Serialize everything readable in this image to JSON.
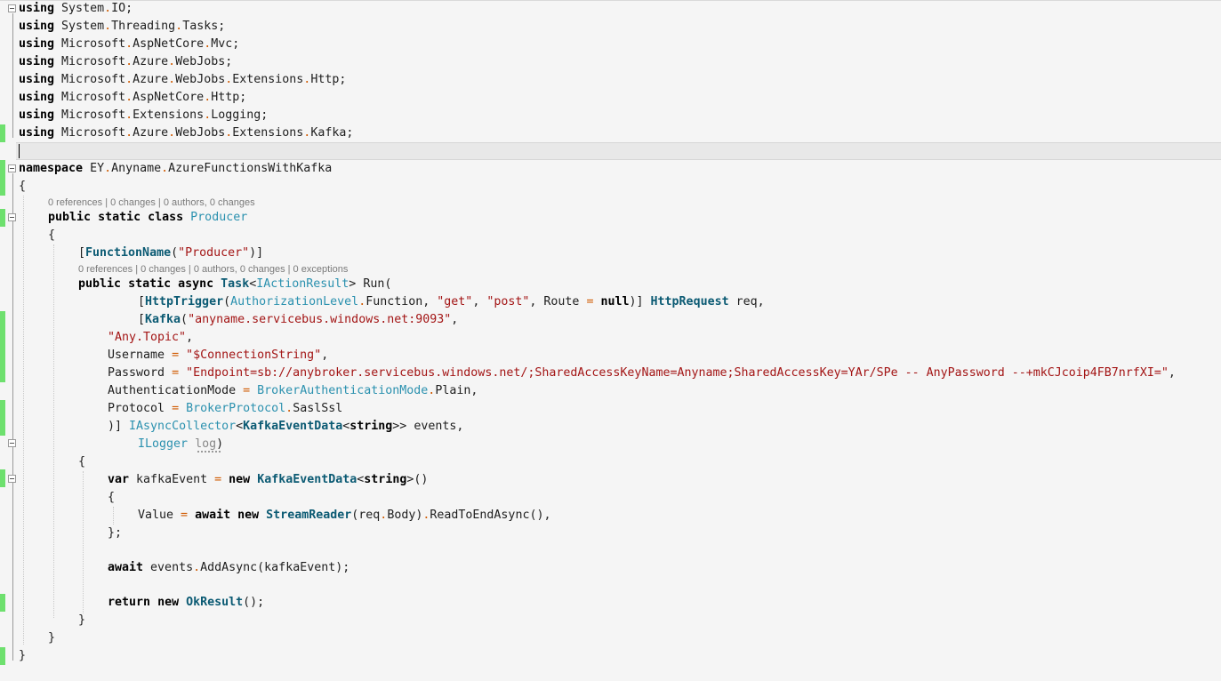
{
  "editor": {
    "lens": {
      "class_lens": "0 references | 0 changes | 0 authors, 0 changes",
      "method_lens": "0 references | 0 changes | 0 authors, 0 changes | 0 exceptions"
    },
    "usings": [
      "System.IO",
      "System.Threading.Tasks",
      "Microsoft.AspNetCore.Mvc",
      "Microsoft.Azure.WebJobs",
      "Microsoft.Azure.WebJobs.Extensions.Http",
      "Microsoft.AspNetCore.Http",
      "Microsoft.Extensions.Logging",
      "Microsoft.Azure.WebJobs.Extensions.Kafka"
    ],
    "ns": "EY.Anyname.AzureFunctionsWithKafka",
    "class_name": "Producer",
    "function_name": "\"Producer\"",
    "task_type": "Task",
    "iaction_result": "IActionResult",
    "method_name": "Run",
    "http_trigger": "HttpTrigger",
    "auth_level": "AuthorizationLevel",
    "auth_member": "Function",
    "verb_get": "\"get\"",
    "verb_post": "\"post\"",
    "route_kw": "Route",
    "null_kw": "null",
    "http_request": "HttpRequest",
    "req_param": "req",
    "kafka_attr": "Kafka",
    "broker": "\"anyname.servicebus.windows.net:9093\"",
    "topic": "\"Any.Topic\"",
    "username_kw": "Username",
    "username_val": "\"$ConnectionString\"",
    "password_kw": "Password",
    "password_val": "\"Endpoint=sb://anybroker.servicebus.windows.net/;SharedAccessKeyName=Anyname;SharedAccessKey=YAr/SPe -- AnyPassword --+mkCJcoip4FB7nrfXI=\"",
    "authmode_kw": "AuthenticationMode",
    "authmode_type": "BrokerAuthenticationMode",
    "authmode_member": "Plain",
    "protocol_kw": "Protocol",
    "protocol_type": "BrokerProtocol",
    "protocol_member": "SaslSsl",
    "collector": "IAsyncCollector",
    "kafka_event_data": "KafkaEventData",
    "string_kw": "string",
    "events_param": "events",
    "ilogger": "ILogger",
    "log_param": "log",
    "var_kw": "var",
    "kafka_event_var": "kafkaEvent",
    "new_kw": "new",
    "value_kw": "Value",
    "await_kw": "await",
    "stream_reader": "StreamReader",
    "req_body": "req.Body",
    "read_to_end": "ReadToEndAsync",
    "events_add": "events.AddAsync",
    "return_kw": "return",
    "ok_result": "OkResult",
    "using_kw": "using",
    "namespace_kw": "namespace",
    "public_kw": "public",
    "static_kw": "static",
    "class_kw": "class",
    "async_kw": "async",
    "function_name_attr": "FunctionName"
  }
}
